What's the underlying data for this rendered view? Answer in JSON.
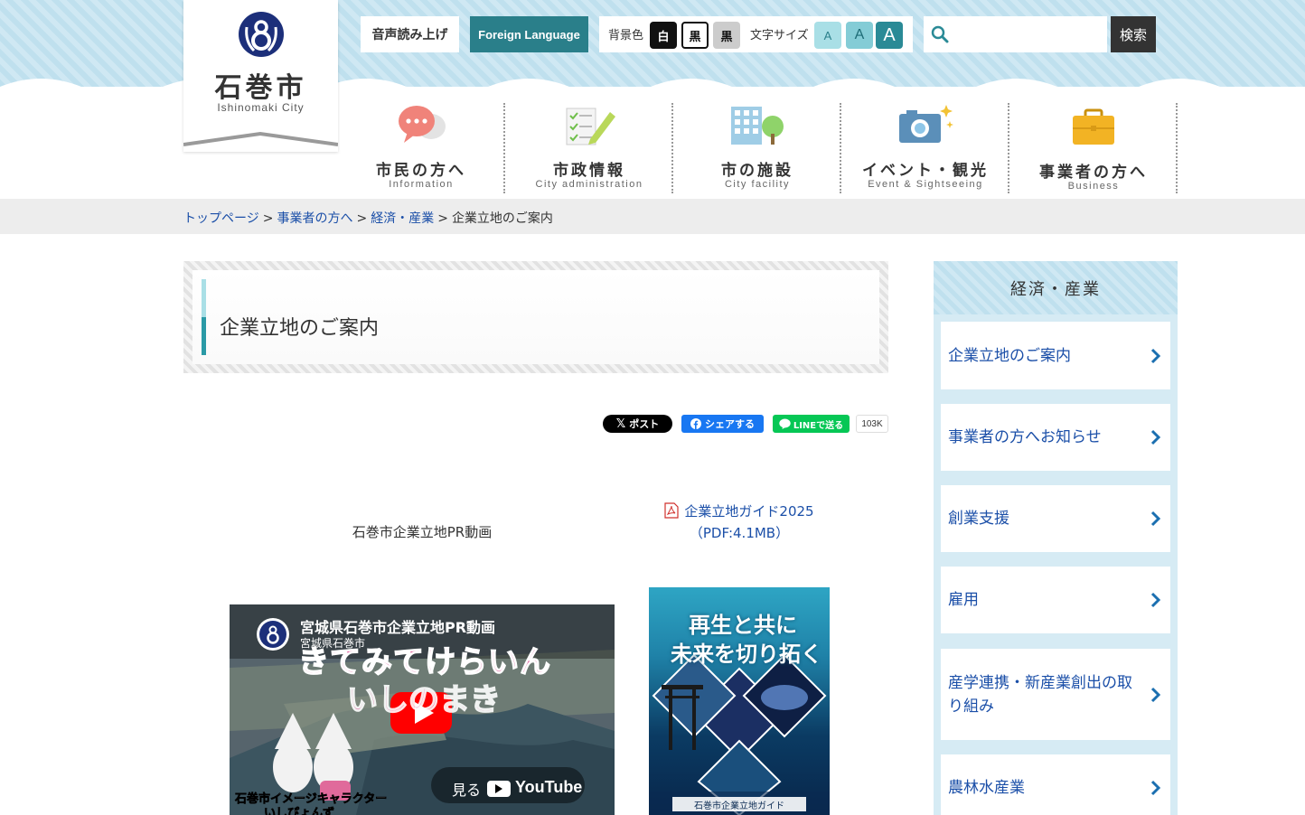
{
  "logo": {
    "name": "石巻市",
    "sub": "Ishinomaki City"
  },
  "toolbar": {
    "voice_label": "音声読み上げ",
    "foreign_label": "Foreign Language",
    "bg_label": "背景色",
    "bg_options": [
      "白",
      "黒",
      "黒"
    ],
    "fontsize_label": "文字サイズ",
    "fontsize_options": [
      "A",
      "A",
      "A"
    ],
    "search_placeholder": "",
    "search_button": "検索"
  },
  "nav": [
    {
      "label": "市民の方へ",
      "sub": "Information",
      "icon": "speech-bubbles-icon"
    },
    {
      "label": "市政情報",
      "sub": "City administration",
      "icon": "checklist-pencil-icon"
    },
    {
      "label": "市の施設",
      "sub": "City facility",
      "icon": "building-tree-icon"
    },
    {
      "label": "イベント・観光",
      "sub": "Event & Sightseeing",
      "icon": "camera-icon"
    },
    {
      "label": "事業者の方へ",
      "sub": "Business",
      "icon": "briefcase-icon"
    }
  ],
  "breadcrumb": [
    {
      "label": "トップページ",
      "link": true
    },
    {
      "label": "事業者の方へ",
      "link": true
    },
    {
      "label": "経済・産業",
      "link": true
    },
    {
      "label": "企業立地のご案内",
      "link": false
    }
  ],
  "breadcrumb_sep": ">",
  "page_title": "企業立地のご案内",
  "share": {
    "x_label": "ポスト",
    "fb_label": "シェアする",
    "line_label": "LINEで送る",
    "count": "103K"
  },
  "content": {
    "video_caption": "石巻市企業立地PR動画",
    "pdf_link_line1": "企業立地ガイド2025",
    "pdf_link_line2": "（PDF:4.1MB）",
    "video": {
      "title": "宮城県石巻市企業立地PR動画",
      "channel": "宮城県石巻市",
      "overlay_1": "きてみてけらいん",
      "overlay_2": "いしのまき",
      "watch_on": "見る",
      "brand": "YouTube",
      "footer_line1": "石巻市イメージキャラクター",
      "footer_line2": "いしぴょんず"
    },
    "guide": {
      "headline_1": "再生と共に",
      "headline_2": "未来を切り拓く",
      "footer": "石巻市企業立地ガイド"
    }
  },
  "sidebar": {
    "heading": "経済・産業",
    "items": [
      {
        "label": "企業立地のご案内"
      },
      {
        "label": "事業者の方へお知らせ"
      },
      {
        "label": "創業支援"
      },
      {
        "label": "雇用"
      },
      {
        "label": "産学連携・新産業創出の取り組み"
      },
      {
        "label": "農林水産業"
      }
    ]
  },
  "colors": {
    "accent_teal": "#2a7f8a",
    "link_blue": "#1b4fa8",
    "header_blue": "#cfe8f3"
  }
}
